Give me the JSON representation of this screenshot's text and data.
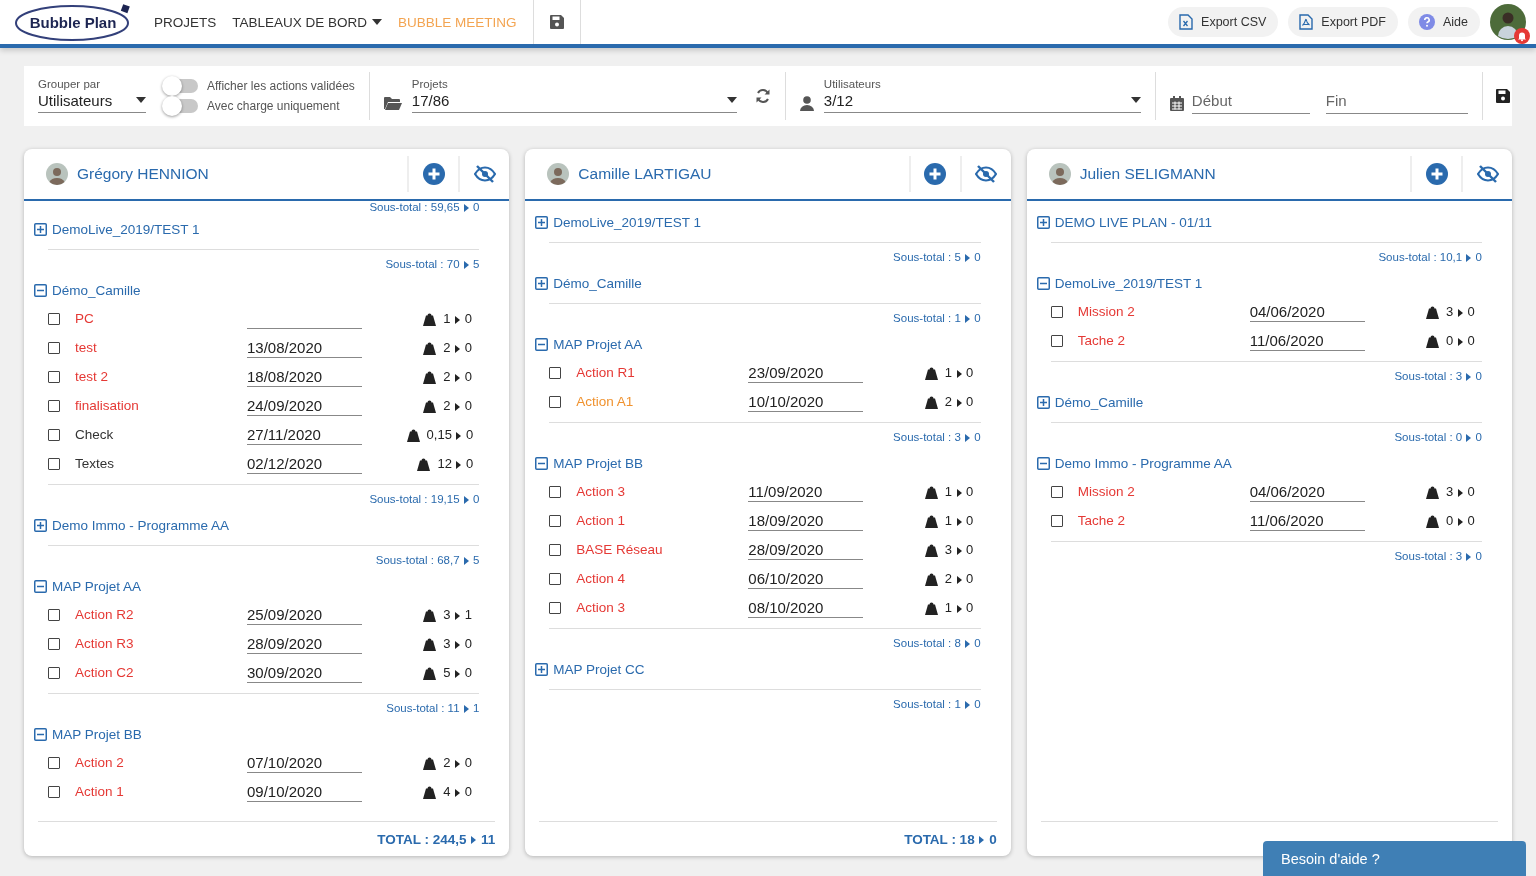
{
  "nav": {
    "logo": "Bubble Plan",
    "links": [
      {
        "label": "PROJETS",
        "selected": false,
        "dropdown": false
      },
      {
        "label": "TABLEAUX DE BORD",
        "selected": false,
        "dropdown": true
      },
      {
        "label": "BUBBLE MEETING",
        "selected": true,
        "dropdown": false
      }
    ],
    "actions": [
      {
        "label": "Export CSV",
        "kind": "csv"
      },
      {
        "label": "Export PDF",
        "kind": "pdf"
      },
      {
        "label": "Aide",
        "kind": "help"
      }
    ],
    "notification": true
  },
  "filters": {
    "group_by": {
      "label": "Grouper par",
      "value": "Utilisateurs"
    },
    "toggles": [
      {
        "label": "Afficher les actions validées",
        "on": false
      },
      {
        "label": "Avec charge uniquement",
        "on": false
      }
    ],
    "projects": {
      "label": "Projets",
      "value": "17/86"
    },
    "users": {
      "label": "Utilisateurs",
      "value": "3/12"
    },
    "start": {
      "placeholder": "Début"
    },
    "end": {
      "placeholder": "Fin"
    }
  },
  "columns": [
    {
      "user": "Grégory HENNION",
      "top_subtotal": {
        "label": "Sous-total : 59,65",
        "value": "0"
      },
      "groups": [
        {
          "name": "DemoLive_2019/TEST 1",
          "expanded": false,
          "subtotal": {
            "label": "Sous-total : 70",
            "value": "5"
          }
        },
        {
          "name": "Démo_Camille",
          "expanded": true,
          "items": [
            {
              "name": "PC",
              "color": "#e53935",
              "checked": false,
              "load": "1",
              "remaining": "0"
            },
            {
              "name": "test",
              "color": "#e53935",
              "checked": false,
              "date": "13/08/2020",
              "load": "2",
              "remaining": "0"
            },
            {
              "name": "test 2",
              "color": "#e53935",
              "checked": false,
              "date": "18/08/2020",
              "load": "2",
              "remaining": "0"
            },
            {
              "name": "finalisation",
              "color": "#e53935",
              "checked": false,
              "date": "24/09/2020",
              "load": "2",
              "remaining": "0"
            },
            {
              "name": "Check",
              "color": "#333333",
              "checked": false,
              "date": "27/11/2020",
              "load": "0,15",
              "remaining": "0"
            },
            {
              "name": "Textes",
              "color": "#333333",
              "checked": false,
              "date": "02/12/2020",
              "load": "12",
              "remaining": "0"
            }
          ],
          "subtotal": {
            "label": "Sous-total : 19,15",
            "value": "0"
          }
        },
        {
          "name": "Demo Immo - Programme AA",
          "expanded": false,
          "subtotal": {
            "label": "Sous-total : 68,7",
            "value": "5"
          }
        },
        {
          "name": "MAP Projet AA",
          "expanded": true,
          "items": [
            {
              "name": "Action R2",
              "color": "#e53935",
              "checked": false,
              "date": "25/09/2020",
              "load": "3",
              "remaining": "1"
            },
            {
              "name": "Action R3",
              "color": "#e53935",
              "checked": false,
              "date": "28/09/2020",
              "load": "3",
              "remaining": "0"
            },
            {
              "name": "Action C2",
              "color": "#e53935",
              "checked": false,
              "date": "30/09/2020",
              "load": "5",
              "remaining": "0"
            }
          ],
          "subtotal": {
            "label": "Sous-total : 11",
            "value": "1"
          }
        },
        {
          "name": "MAP Projet BB",
          "expanded": true,
          "items": [
            {
              "name": "Action 2",
              "color": "#e53935",
              "checked": false,
              "date": "07/10/2020",
              "load": "2",
              "remaining": "0"
            },
            {
              "name": "Action 1",
              "color": "#e53935",
              "checked": false,
              "date": "09/10/2020",
              "load": "4",
              "remaining": "0"
            }
          ]
        }
      ],
      "total": {
        "label": "TOTAL : 244,5",
        "value": "11"
      }
    },
    {
      "user": "Camille LARTIGAU",
      "groups": [
        {
          "name": "DemoLive_2019/TEST 1",
          "expanded": false,
          "subtotal": {
            "label": "Sous-total : 5",
            "value": "0"
          }
        },
        {
          "name": "Démo_Camille",
          "expanded": false,
          "subtotal": {
            "label": "Sous-total : 1",
            "value": "0"
          }
        },
        {
          "name": "MAP Projet AA",
          "expanded": true,
          "items": [
            {
              "name": "Action R1",
              "color": "#e53935",
              "checked": false,
              "date": "23/09/2020",
              "load": "1",
              "remaining": "0"
            },
            {
              "name": "Action A1",
              "color": "#f0922e",
              "checked": false,
              "date": "10/10/2020",
              "load": "2",
              "remaining": "0"
            }
          ],
          "subtotal": {
            "label": "Sous-total : 3",
            "value": "0"
          }
        },
        {
          "name": "MAP Projet BB",
          "expanded": true,
          "items": [
            {
              "name": "Action 3",
              "color": "#e53935",
              "checked": false,
              "date": "11/09/2020",
              "load": "1",
              "remaining": "0"
            },
            {
              "name": "Action 1",
              "color": "#e53935",
              "checked": false,
              "date": "18/09/2020",
              "load": "1",
              "remaining": "0"
            },
            {
              "name": "BASE Réseau",
              "color": "#e53935",
              "checked": false,
              "date": "28/09/2020",
              "load": "3",
              "remaining": "0"
            },
            {
              "name": "Action 4",
              "color": "#e53935",
              "checked": false,
              "date": "06/10/2020",
              "load": "2",
              "remaining": "0"
            },
            {
              "name": "Action 3",
              "color": "#e53935",
              "checked": false,
              "date": "08/10/2020",
              "load": "1",
              "remaining": "0"
            }
          ],
          "subtotal": {
            "label": "Sous-total : 8",
            "value": "0"
          }
        },
        {
          "name": "MAP Projet CC",
          "expanded": false,
          "subtotal": {
            "label": "Sous-total : 1",
            "value": "0"
          }
        }
      ],
      "total": {
        "label": "TOTAL : 18",
        "value": "0"
      }
    },
    {
      "user": "Julien SELIGMANN",
      "groups": [
        {
          "name": "DEMO LIVE PLAN - 01/11",
          "expanded": false,
          "subtotal": {
            "label": "Sous-total : 10,1",
            "value": "0"
          }
        },
        {
          "name": "DemoLive_2019/TEST 1",
          "expanded": true,
          "items": [
            {
              "name": "Mission 2",
              "color": "#e53935",
              "checked": false,
              "date": "04/06/2020",
              "load": "3",
              "remaining": "0"
            },
            {
              "name": "Tache 2",
              "color": "#e53935",
              "checked": false,
              "date": "11/06/2020",
              "load": "0",
              "remaining": "0"
            }
          ],
          "subtotal": {
            "label": "Sous-total : 3",
            "value": "0"
          }
        },
        {
          "name": "Démo_Camille",
          "expanded": false,
          "subtotal": {
            "label": "Sous-total : 0",
            "value": "0"
          }
        },
        {
          "name": "Demo Immo - Programme AA",
          "expanded": true,
          "items": [
            {
              "name": "Mission 2",
              "color": "#e53935",
              "checked": false,
              "date": "04/06/2020",
              "load": "3",
              "remaining": "0"
            },
            {
              "name": "Tache 2",
              "color": "#e53935",
              "checked": false,
              "date": "11/06/2020",
              "load": "0",
              "remaining": "0"
            }
          ],
          "subtotal": {
            "label": "Sous-total : 3",
            "value": "0"
          }
        }
      ]
    }
  ],
  "help_button": "Besoin d'aide ?"
}
